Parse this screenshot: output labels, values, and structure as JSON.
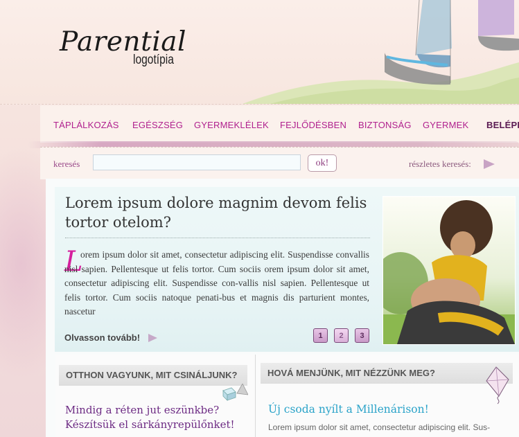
{
  "logo": {
    "main": "Parential",
    "sub": "logotípia"
  },
  "nav": {
    "items": [
      {
        "label": "TÁPLÁLKOZÁS"
      },
      {
        "label": "EGÉSZSÉG"
      },
      {
        "label": "GYERMEKLÉLEK"
      },
      {
        "label": "FEJLŐDÉSBEN"
      },
      {
        "label": "BIZTONSÁG"
      },
      {
        "label": "GYERMEK"
      },
      {
        "label": "BELÉPÉS"
      }
    ]
  },
  "search": {
    "label": "keresés",
    "value": "",
    "button": "ok!",
    "advanced": "részletes keresés:"
  },
  "feature": {
    "title": "Lorem ipsum dolore magnim devom felis tortor otelom?",
    "dropcap": "L",
    "text": "orem ipsum dolor sit amet, consectetur adipiscing elit. Suspendisse convallis nisl sapien. Pellentesque ut felis tortor. Cum sociis orem ipsum dolor sit amet, consectetur adipiscing elit. Suspendisse con-vallis nisl sapien. Pellentesque ut felis tortor. Cum sociis natoque penati-bus et magnis dis parturient montes, nascetur",
    "read_more": "Olvasson tovább!",
    "pages": [
      "1",
      "2",
      "3"
    ]
  },
  "left_box": {
    "heading": "OTTHON VAGYUNK, MIT CSINÁLJUNK?",
    "text": "Mindig a réten jut eszünkbe? Készítsük el sárkányrepülőnket!"
  },
  "right_box": {
    "heading": "HOVÁ MENJÜNK, MIT NÉZZÜNK MEG?",
    "title": "Új csoda nyílt a Millenárison!",
    "text": "Lorem ipsum dolor sit amet, consectetur adipiscing elit. Sus-"
  },
  "colors": {
    "nav": "#b0208e",
    "dropcap": "#d51f9d",
    "link": "#2aa3c9",
    "purple_text": "#6c2a83"
  }
}
